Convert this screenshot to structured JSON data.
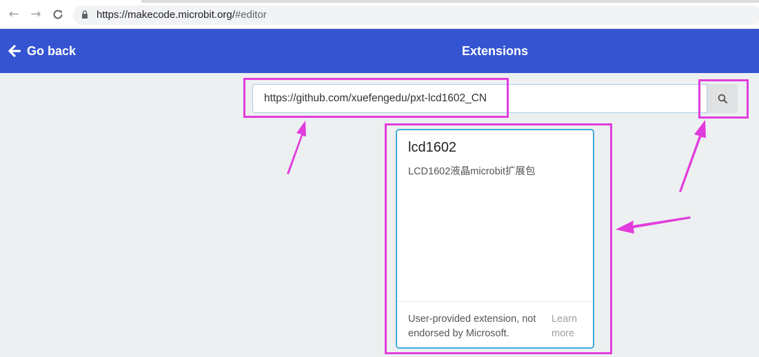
{
  "browser": {
    "url_host": "https://makecode.microbit.org/",
    "url_path": "#editor"
  },
  "header": {
    "back_label": "Go back",
    "title": "Extensions"
  },
  "search": {
    "value": "https://github.com/xuefengedu/pxt-lcd1602_CN"
  },
  "extension_card": {
    "title": "lcd1602",
    "description": "LCD1602液晶microbit扩展包",
    "footer_note": "User-provided extension, not endorsed by Microsoft.",
    "learn_more": "Learn more"
  },
  "colors": {
    "header_bg": "#3454d1",
    "page_bg": "#ecf0f1",
    "card_border": "#3fa9dd",
    "annotation": "#e23cdc"
  }
}
